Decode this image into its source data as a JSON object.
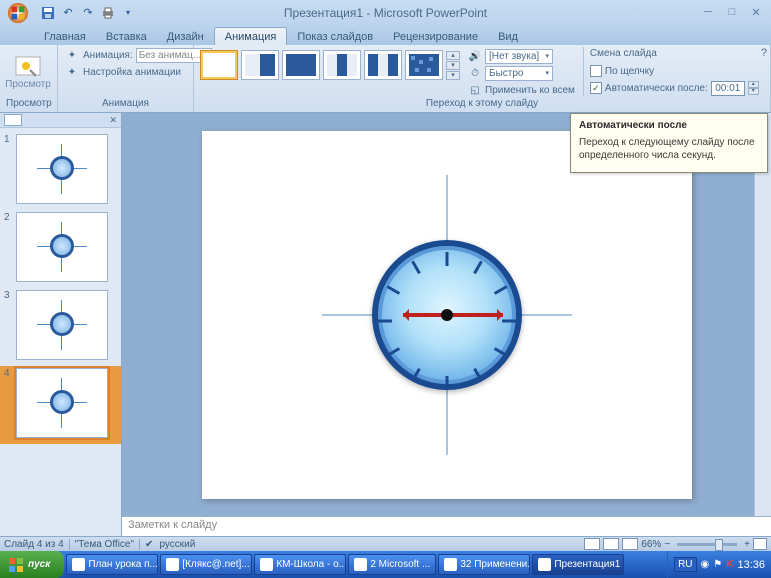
{
  "title": "Презентация1 - Microsoft PowerPoint",
  "tabs": [
    "Главная",
    "Вставка",
    "Дизайн",
    "Анимация",
    "Показ слайдов",
    "Рецензирование",
    "Вид"
  ],
  "active_tab": 3,
  "ribbon": {
    "preview_group": {
      "button": "Просмотр",
      "label": "Просмотр"
    },
    "anim_group": {
      "row1_label": "Анимация:",
      "row1_value": "Без анимац...",
      "row2_label": "Настройка анимации",
      "label": "Анимация"
    },
    "transition_group": {
      "sound_label": "[Нет звука]",
      "speed_label": "Быстро",
      "apply_all": "Применить ко всем",
      "label": "Переход к этому слайду"
    },
    "advance_group": {
      "title": "Смена слайда",
      "on_click": "По щелчку",
      "auto_after": "Автоматически после:",
      "time_value": "00:01"
    }
  },
  "tooltip": {
    "title": "Автоматически после",
    "body": "Переход к следующему слайду после определенного числа секунд."
  },
  "notes_placeholder": "Заметки к слайду",
  "status": {
    "slide": "Слайд 4 из 4",
    "theme": "\"Тема Office\"",
    "lang": "русский",
    "zoom": "66%"
  },
  "taskbar": {
    "start": "пуск",
    "items": [
      "План урока п...",
      "[Клякс@.net]...",
      "КМ-Школа - о...",
      "2 Microsoft ...",
      "32 Применени...",
      "Презентация1"
    ],
    "active_item": 5,
    "lang": "RU",
    "time": "13:36"
  },
  "slide_count": 4,
  "selected_slide": 4
}
